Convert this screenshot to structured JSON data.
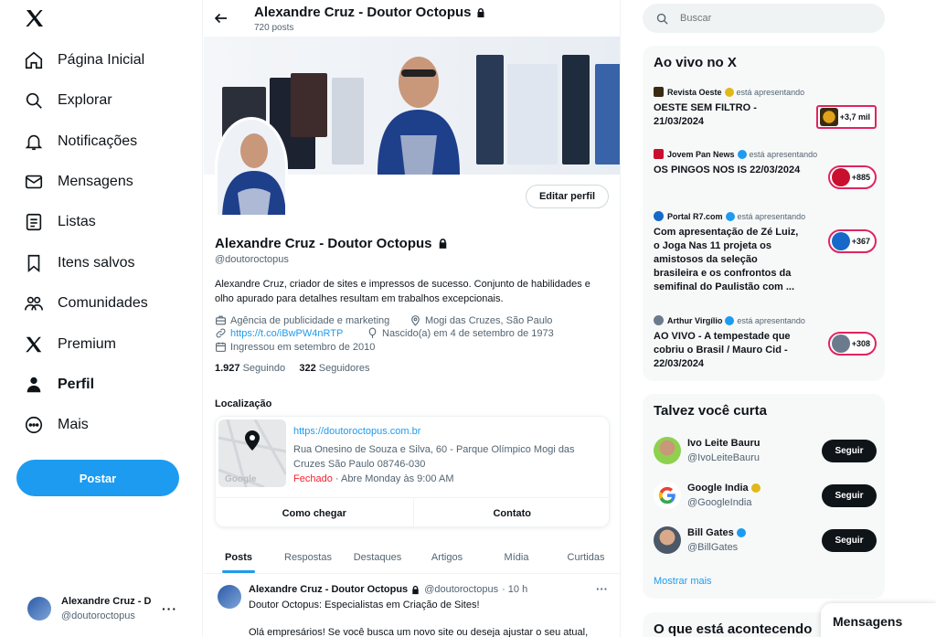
{
  "sidebar": {
    "logo": "x-logo",
    "items": [
      {
        "label": "Página Inicial",
        "icon": "home-icon"
      },
      {
        "label": "Explorar",
        "icon": "search-icon"
      },
      {
        "label": "Notificações",
        "icon": "bell-icon"
      },
      {
        "label": "Mensagens",
        "icon": "mail-icon"
      },
      {
        "label": "Listas",
        "icon": "list-icon"
      },
      {
        "label": "Itens salvos",
        "icon": "bookmark-icon"
      },
      {
        "label": "Comunidades",
        "icon": "communities-icon"
      },
      {
        "label": "Premium",
        "icon": "x-icon"
      },
      {
        "label": "Perfil",
        "icon": "person-icon",
        "active": true
      },
      {
        "label": "Mais",
        "icon": "more-icon"
      }
    ],
    "post_button": "Postar",
    "account": {
      "name": "Alexandre Cruz - D",
      "handle": "@doutoroctopus",
      "more": "···"
    }
  },
  "profile": {
    "header_name": "Alexandre Cruz - Doutor Octopus",
    "header_posts": "720 posts",
    "edit_button": "Editar perfil",
    "name": "Alexandre Cruz - Doutor Octopus",
    "handle": "@doutoroctopus",
    "bio": "Alexandre Cruz, criador de sites e impressos de sucesso. Conjunto de habilidades e olho apurado para detalhes resultam em trabalhos excepcionais.",
    "category": "Agência de publicidade e marketing",
    "location": "Mogi das Cruzes, São Paulo",
    "link": "https://t.co/iBwPW4nRTP",
    "birth": "Nascido(a) em 4 de setembro de 1973",
    "joined": "Ingressou em setembro de 2010",
    "following_count": "1.927",
    "following_label": "Seguindo",
    "followers_count": "322",
    "followers_label": "Seguidores"
  },
  "location_card": {
    "label": "Localização",
    "url": "https://doutoroctopus.com.br",
    "address": "Rua Onesino de Souza e Silva, 60 - Parque Olímpico Mogi das Cruzes São Paulo 08746-030",
    "status_closed": "Fechado",
    "status_rest": " · Abre Monday às 9:00 AM",
    "map_logo": "Google",
    "directions": "Como chegar",
    "contact": "Contato"
  },
  "tabs": [
    "Posts",
    "Respostas",
    "Destaques",
    "Artigos",
    "Mídia",
    "Curtidas"
  ],
  "post": {
    "author": "Alexandre Cruz - Doutor Octopus",
    "handle": "@doutoroctopus",
    "time": "· 10 h",
    "more": "···",
    "line1": "Doutor Octopus: Especialistas em Criação de Sites!",
    "line2": "Olá empresários! Se você busca um novo site ou deseja ajustar o seu atual,"
  },
  "search": {
    "placeholder": "Buscar"
  },
  "live": {
    "title": "Ao vivo no X",
    "presenting": "está apresentando",
    "items": [
      {
        "host": "Revista Oeste",
        "title": "OESTE SEM FILTRO - 21/03/2024",
        "count": "+3,7 mil",
        "logo_color": "#3a2a10",
        "verify_color": "#e2b719"
      },
      {
        "host": "Jovem Pan News",
        "title": "OS PINGOS NOS IS 22/03/2024",
        "count": "+885",
        "logo_color": "#c8102e",
        "verify_color": "#1d9bf0"
      },
      {
        "host": "Portal R7.com",
        "title": "Com apresentação de Zé Luiz, o Joga Nas 11 projeta os amistosos da seleção brasileira e os confrontos da semifinal do Paulistão com ...",
        "count": "+367",
        "logo_color": "#1769c9",
        "verify_color": "#1d9bf0"
      },
      {
        "host": "Arthur Virgílio",
        "title": "AO VIVO - A tempestade que cobriu o Brasil / Mauro Cid - 22/03/2024",
        "count": "+308",
        "logo_color": "#6b7a8c",
        "verify_color": "#1d9bf0"
      }
    ]
  },
  "who_to_follow": {
    "title": "Talvez você curta",
    "follow_label": "Seguir",
    "show_more": "Mostrar mais",
    "items": [
      {
        "name": "Ivo Leite Bauru",
        "handle": "@IvoLeiteBauru",
        "verified": false
      },
      {
        "name": "Google India",
        "handle": "@GoogleIndia",
        "verified": true,
        "verify_color": "#e2b719"
      },
      {
        "name": "Bill Gates",
        "handle": "@BillGates",
        "verified": true,
        "verify_color": "#1d9bf0"
      }
    ]
  },
  "happening_title": "O que está acontecendo",
  "messages_drawer": "Mensagens",
  "colors": {
    "accent": "#1d9bf0",
    "live_ring": "#e0245e"
  }
}
